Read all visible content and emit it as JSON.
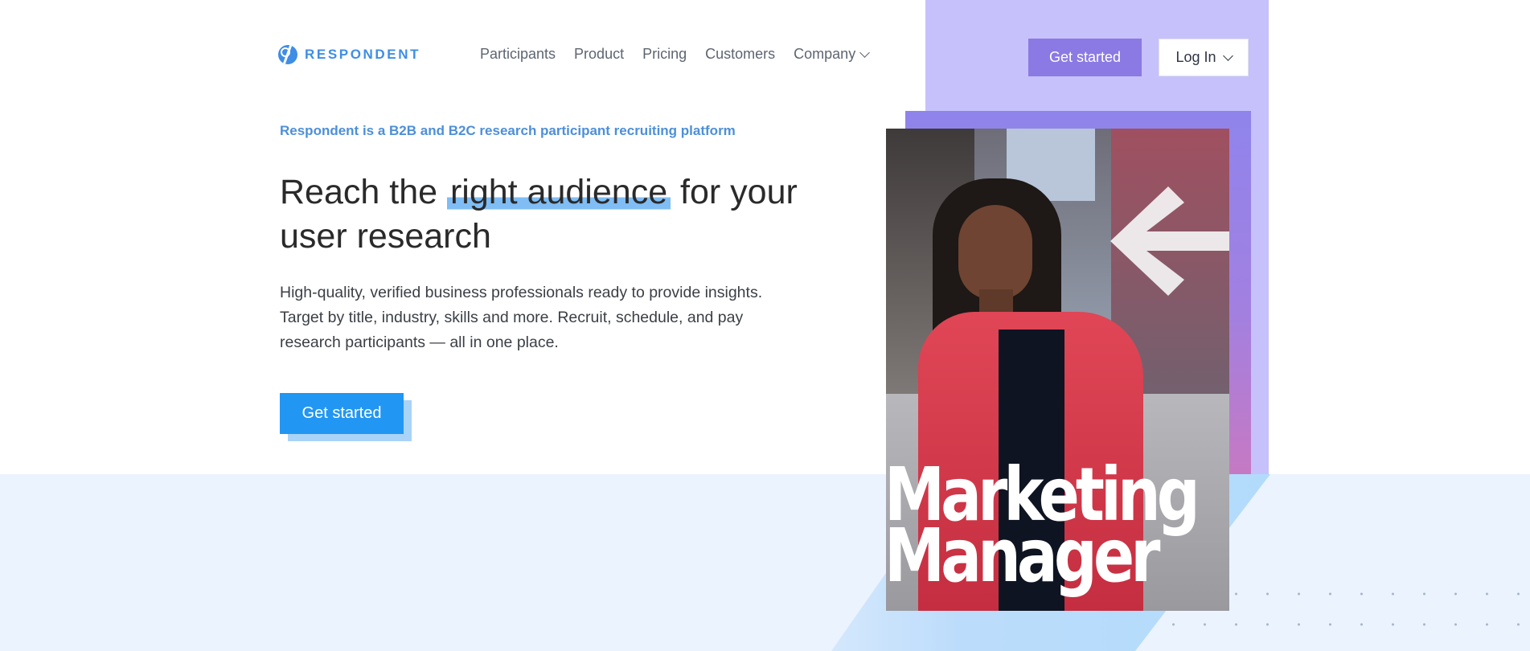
{
  "brand": {
    "name": "RESPONDENT",
    "color": "#3e8ee6"
  },
  "nav": {
    "items": [
      {
        "label": "Participants"
      },
      {
        "label": "Product"
      },
      {
        "label": "Pricing"
      },
      {
        "label": "Customers"
      },
      {
        "label": "Company",
        "has_dropdown": true
      }
    ]
  },
  "header": {
    "get_started_label": "Get started",
    "login_label": "Log In"
  },
  "hero": {
    "eyebrow": "Respondent is a B2B and B2C research participant recruiting platform",
    "headline_before": "Reach the ",
    "headline_highlight": "right audience",
    "headline_after": " for your user research",
    "subtext": "High-quality, verified business professionals ready to provide insights. Target by title, industry, skills and more. Recruit, schedule, and pay research participants — all in one place.",
    "cta_label": "Get started"
  },
  "hero_image": {
    "caption_line1": "Marketing",
    "caption_line2": "Manager"
  },
  "colors": {
    "accent_purple": "#8b79e4",
    "light_purple": "#c6c1fb",
    "cta_blue": "#2196f3",
    "highlight_blue": "#7fbdf4",
    "band_blue": "#ebf3fe"
  }
}
